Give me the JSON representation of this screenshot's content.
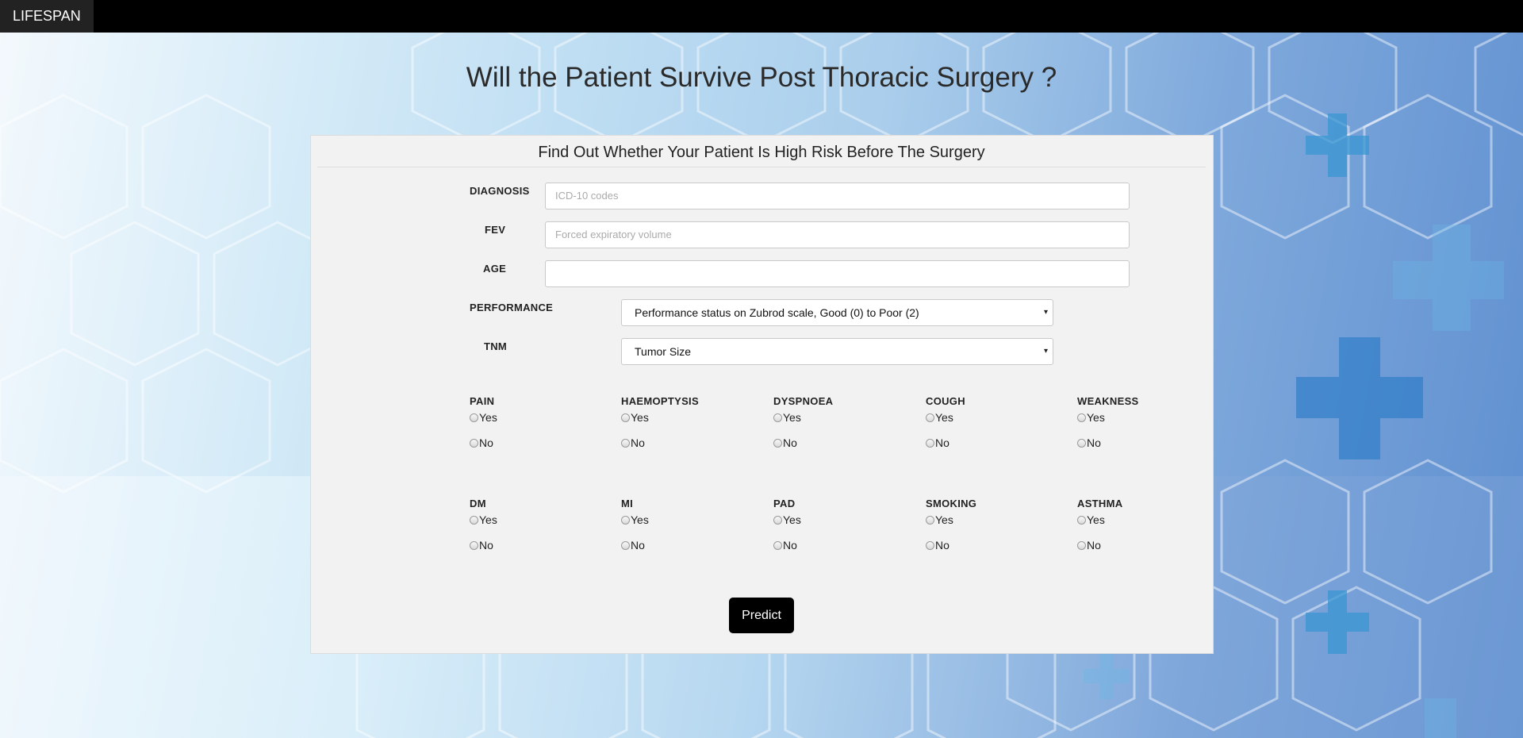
{
  "navbar": {
    "brand": "LIFESPAN"
  },
  "headline": "Will the Patient Survive Post Thoracic Surgery ?",
  "panel": {
    "title": "Find Out Whether Your Patient Is High Risk Before The Surgery",
    "fields": {
      "diagnosis": {
        "label": "DIAGNOSIS",
        "placeholder": "ICD-10 codes",
        "value": ""
      },
      "fev": {
        "label": "FEV",
        "placeholder": "Forced expiratory volume",
        "value": ""
      },
      "age": {
        "label": "AGE",
        "placeholder": "",
        "value": ""
      },
      "performance": {
        "label": "PERFORMANCE",
        "selected": "Performance status on Zubrod scale, Good (0) to Poor (2)"
      },
      "tnm": {
        "label": "TNM",
        "selected": "Tumor Size"
      }
    },
    "yes_label": "Yes",
    "no_label": "No",
    "row1": [
      "PAIN",
      "HAEMOPTYSIS",
      "DYSPNOEA",
      "COUGH",
      "WEAKNESS"
    ],
    "row2": [
      "DM",
      "MI",
      "PAD",
      "SMOKING",
      "ASTHMA"
    ],
    "predict_label": "Predict"
  },
  "icons": {
    "caret": "▾"
  },
  "colors": {
    "navbar": "#000000",
    "brand_bg": "#222222",
    "panel_bg": "#f2f2f2",
    "button": "#000000"
  }
}
